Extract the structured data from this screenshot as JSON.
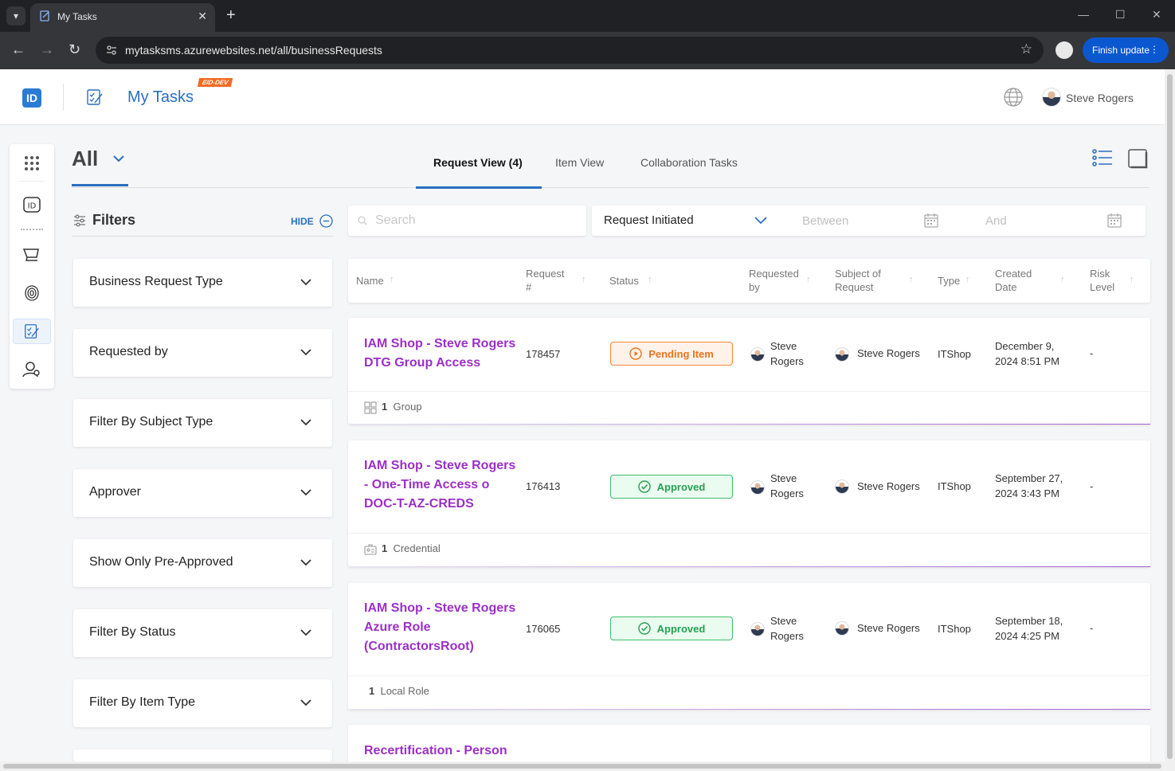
{
  "browser": {
    "tab_title": "My Tasks",
    "url": "mytasksms.azurewebsites.net/all/businessRequests",
    "finish_update_label": "Finish update"
  },
  "header": {
    "app_title": "My Tasks",
    "env_badge": "EID-DEV",
    "user_name": "Steve Rogers"
  },
  "scope": {
    "selected": "All"
  },
  "view_tabs": [
    {
      "label": "Request View (4)",
      "active": true
    },
    {
      "label": "Item View",
      "active": false
    },
    {
      "label": "Collaboration Tasks",
      "active": false
    }
  ],
  "filters": {
    "title": "Filters",
    "hide_label": "HIDE",
    "items": [
      "Business Request Type",
      "Requested by",
      "Filter By Subject Type",
      "Approver",
      "Show Only Pre-Approved",
      "Filter By Status",
      "Filter By Item Type"
    ]
  },
  "search": {
    "placeholder": "Search",
    "value": ""
  },
  "date_filter": {
    "type": "Request Initiated",
    "between_placeholder": "Between",
    "and_placeholder": "And"
  },
  "table": {
    "columns": [
      {
        "l1": "Name",
        "l2": ""
      },
      {
        "l1": "Request",
        "l2": "#"
      },
      {
        "l1": "Status",
        "l2": ""
      },
      {
        "l1": "Requested",
        "l2": "by"
      },
      {
        "l1": "Subject of",
        "l2": "Request"
      },
      {
        "l1": "Type",
        "l2": ""
      },
      {
        "l1": "Created",
        "l2": "Date"
      },
      {
        "l1": "Risk",
        "l2": "Level"
      }
    ],
    "rows": [
      {
        "name_lines": [
          "IAM Shop - Steve Rogers",
          "DTG Group Access"
        ],
        "request_no": "178457",
        "status": "Pending Item",
        "requested_by": [
          "Steve",
          "Rogers"
        ],
        "subject": "Steve Rogers",
        "type": "ITShop",
        "created": [
          "December 9,",
          "2024 8:51 PM"
        ],
        "risk": "-",
        "footer_count": "1",
        "footer_label": "Group"
      },
      {
        "name_lines": [
          "IAM Shop - Steve Rogers",
          "- One-Time Access o",
          "DOC-T-AZ-CREDS"
        ],
        "request_no": "176413",
        "status": "Approved",
        "requested_by": [
          "Steve",
          "Rogers"
        ],
        "subject": "Steve Rogers",
        "type": "ITShop",
        "created": [
          "September 27,",
          "2024 3:43 PM"
        ],
        "risk": "-",
        "footer_count": "1",
        "footer_label": "Credential"
      },
      {
        "name_lines": [
          "IAM Shop - Steve Rogers",
          "Azure Role",
          "(ContractorsRoot)"
        ],
        "request_no": "176065",
        "status": "Approved",
        "requested_by": [
          "Steve",
          "Rogers"
        ],
        "subject": "Steve Rogers",
        "type": "ITShop",
        "created": [
          "September 18,",
          "2024 4:25 PM"
        ],
        "risk": "-",
        "footer_count": "1",
        "footer_label": "Local Role"
      },
      {
        "name_lines": [
          "Recertification - Person"
        ]
      }
    ]
  },
  "colors": {
    "brand_blue": "#2b6fc0",
    "link_purple": "#9b30c6",
    "pending_orange": "#e8741f",
    "approved_green": "#27a052"
  }
}
